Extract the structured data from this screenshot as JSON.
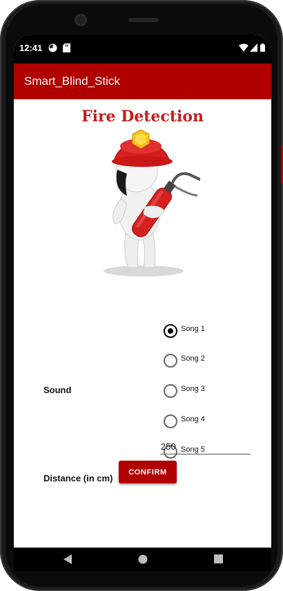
{
  "status_bar": {
    "time": "12:41"
  },
  "app_bar": {
    "title": "Smart_Blind_Stick"
  },
  "page": {
    "title": "Fire Detection"
  },
  "sound": {
    "label": "Sound",
    "options": [
      "Song 1",
      "Song 2",
      "Song 3",
      "Song 4",
      "Song 5"
    ],
    "selected": "Song 1"
  },
  "distance": {
    "label": "Distance (in cm)",
    "value": "250"
  },
  "confirm": {
    "label": "CONFIRM"
  },
  "colors": {
    "primary": "#b00000",
    "title": "#c41e1e"
  },
  "icons": [
    "pie-icon",
    "sd-card-icon",
    "wifi-icon",
    "signal-icon",
    "battery-icon",
    "back-icon",
    "home-icon",
    "recents-icon"
  ]
}
